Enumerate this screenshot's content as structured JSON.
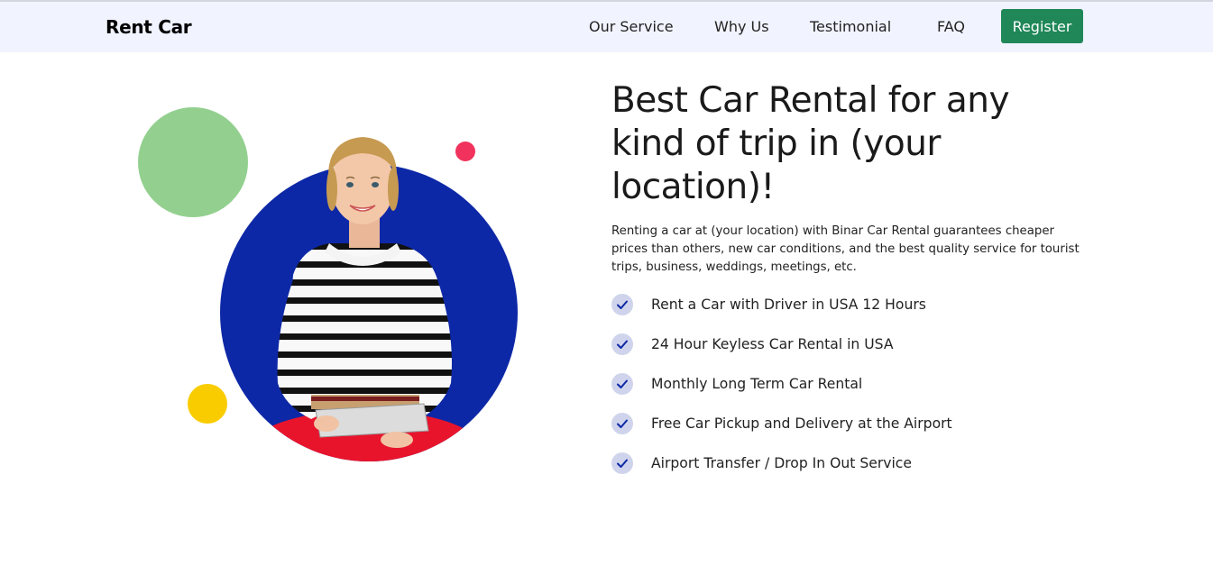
{
  "navbar": {
    "brand": "Rent Car",
    "links": [
      "Our Service",
      "Why Us",
      "Testimonial",
      "FAQ"
    ],
    "register_label": "Register"
  },
  "hero": {
    "headline": "Best Car Rental for any kind of trip in (your location)!",
    "description": "Renting a car at (your location) with Binar Car Rental guarantees cheaper prices than others, new car conditions, and the best quality service for tourist trips, business, weddings, meetings, etc.",
    "features": [
      "Rent a Car with Driver in USA 12 Hours",
      "24 Hour Keyless Car Rental in USA",
      "Monthly Long Term Car Rental",
      "Free Car Pickup and Delivery at the Airport",
      "Airport Transfer / Drop In Out Service"
    ]
  },
  "colors": {
    "navbar_bg": "#f1f3ff",
    "register_bg": "#1f8758",
    "blue_circle": "#0d28a6",
    "green_circle": "#93d08f",
    "yellow_circle": "#f9cc00",
    "pink_circle": "#f1325d",
    "check_bg": "#cfd4ec",
    "check_mark": "#0d28a6"
  },
  "icons": {
    "feature_check": "check-icon"
  }
}
